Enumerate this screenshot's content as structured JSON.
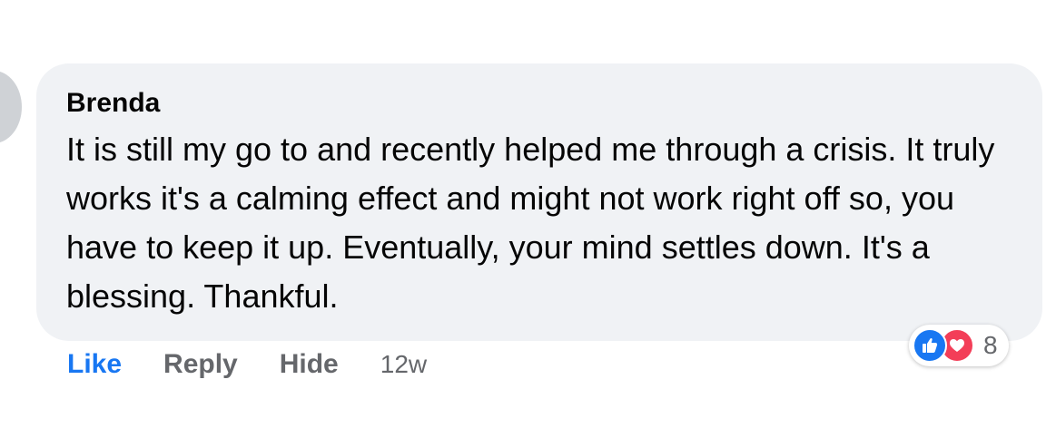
{
  "comment": {
    "author": "Brenda",
    "text": "It is still my go to and recently helped me through a crisis. It truly works it's a calming effect and might not work right off so, you have to keep it up. Eventually, your mind settles down. It's a blessing. Thankful."
  },
  "actions": {
    "like_label": "Like",
    "reply_label": "Reply",
    "hide_label": "Hide",
    "timestamp": "12w"
  },
  "reactions": {
    "types": [
      "like-icon",
      "love-icon"
    ],
    "count": "8"
  },
  "colors": {
    "like_blue": "#1877f2",
    "love_red": "#f33e58",
    "bubble_bg": "#f0f2f5",
    "muted_text": "#65676b"
  }
}
